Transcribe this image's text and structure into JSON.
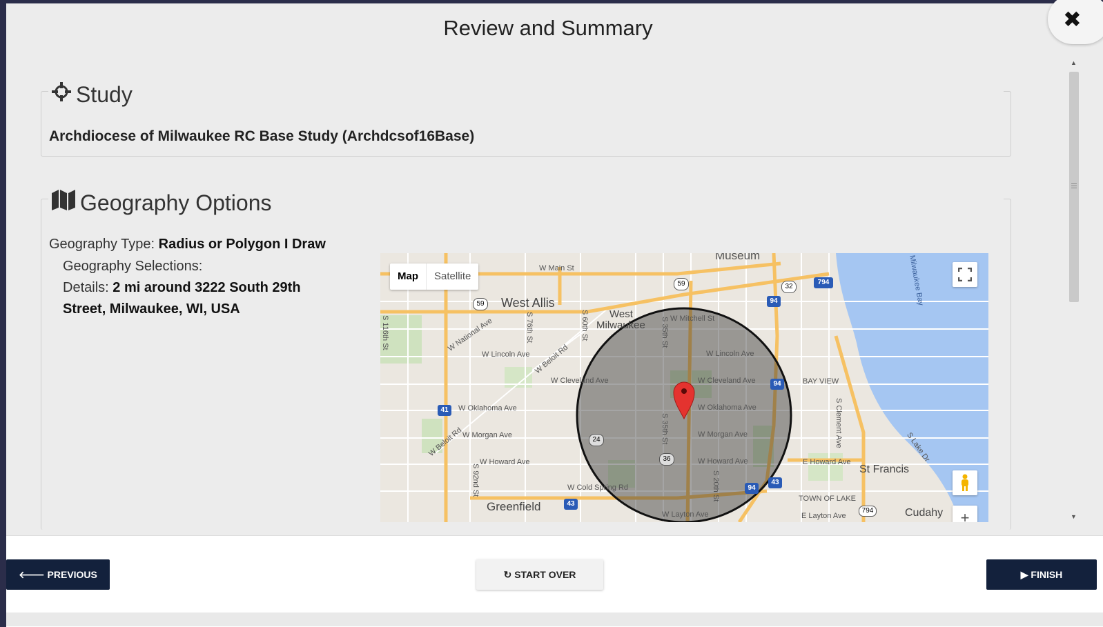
{
  "modal": {
    "title": "Review and Summary",
    "close_icon": "close-icon"
  },
  "study": {
    "heading": "Study",
    "icon": "crosshair-icon",
    "name": "Archdiocese of Milwaukee RC Base Study (Archdcsof16Base)"
  },
  "geography": {
    "heading": "Geography Options",
    "icon": "map-icon",
    "type_label": "Geography Type:",
    "type_value": "Radius or Polygon I Draw",
    "selections_label": "Geography Selections:",
    "details_label": "Details:",
    "details_value_1": "2 mi around 3222 South 29th",
    "details_value_2": "Street, Milwaukee, WI, USA"
  },
  "map": {
    "toggle_map": "Map",
    "toggle_satellite": "Satellite",
    "zoom_in": "+",
    "labels": {
      "west_allis": "West Allis",
      "west": "West",
      "milwaukee": "Milwaukee",
      "greenfield": "Greenfield",
      "st_francis": "St Francis",
      "cudahy": "Cudahy",
      "bay_view": "BAY VIEW",
      "town_of_lake": "TOWN OF LAKE",
      "museum": "Museum",
      "w_main_st": "W Main St",
      "w_lincoln_ave_1": "W Lincoln Ave",
      "w_lincoln_ave_2": "W Lincoln Ave",
      "w_cleveland_ave_1": "W Cleveland Ave",
      "w_cleveland_ave_2": "W Cleveland Ave",
      "w_oklahoma_ave_1": "W Oklahoma Ave",
      "w_oklahoma_ave_2": "W Oklahoma Ave",
      "w_morgan_ave_1": "W Morgan Ave",
      "w_morgan_ave_2": "W Morgan Ave",
      "w_howard_ave_1": "W Howard Ave",
      "w_howard_ave_2": "W Howard Ave",
      "e_howard_ave": "E Howard Ave",
      "w_mitchell_st": "W Mitchell St",
      "w_national_ave": "W National Ave",
      "w_beloit_rd_1": "W Beloit Rd",
      "w_beloit_rd_2": "W Beloit Rd",
      "w_cold_spring_rd": "W Cold Spring Rd",
      "w_layton_ave": "W Layton Ave",
      "e_layton_ave": "E Layton Ave",
      "s_lake_dr": "S Lake Dr",
      "milwaukee_bay": "Milwaukee Bay",
      "s_116th_st": "S 116th St",
      "s_76th_st": "S 76th St",
      "s_60th_st": "S 60th St",
      "s_35th_st_1": "S 35th St",
      "s_35th_st_2": "S 35th St",
      "s_20th_st": "S 20th St",
      "s_92nd_st": "S 92nd St",
      "s_clement_ave": "S Clement Ave",
      "hw_59_1": "59",
      "hw_59_2": "59",
      "hw_32": "32",
      "hw_794_1": "794",
      "hw_794_2": "794",
      "hw_94_1": "94",
      "hw_94_2": "94",
      "hw_94_3": "94",
      "hw_41": "41",
      "hw_43_1": "43",
      "hw_43_2": "43",
      "hw_24": "24",
      "hw_36": "36"
    }
  },
  "footer": {
    "previous_label": "PREVIOUS",
    "start_over_label": "START OVER",
    "finish_label": "FINISH"
  },
  "colors": {
    "primary_button": "#13213c",
    "modal_bg": "#ececec",
    "water": "#a5c6f2",
    "highway": "#f6c163"
  }
}
